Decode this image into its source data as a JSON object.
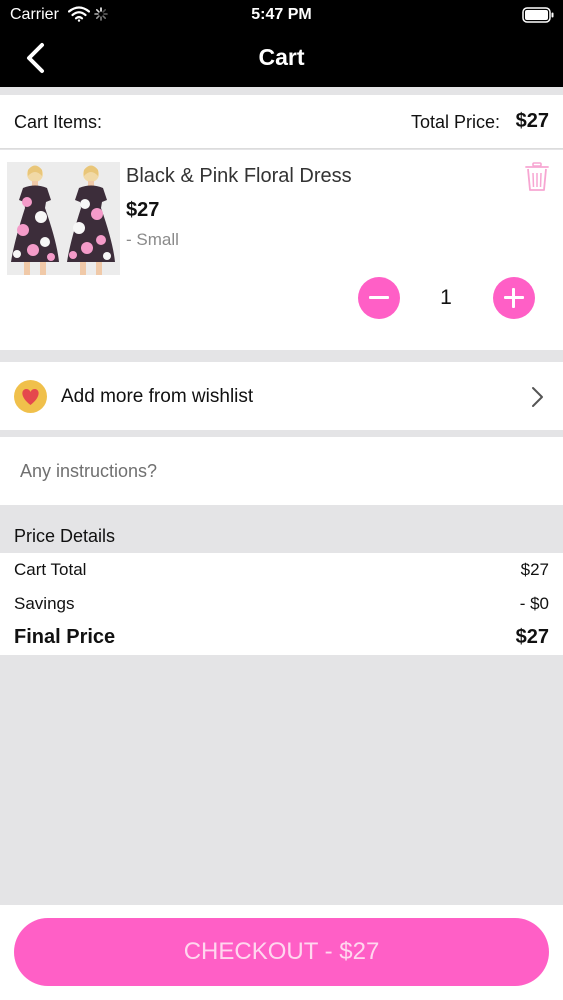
{
  "status_bar": {
    "carrier": "Carrier",
    "time": "5:47 PM"
  },
  "nav": {
    "title": "Cart",
    "back_icon": "chevron-left-icon"
  },
  "cart_header": {
    "items_label": "Cart Items:",
    "total_price_label": "Total Price:",
    "total_price_value": "$27"
  },
  "items": [
    {
      "name": "Black & Pink Floral Dress",
      "price": "$27",
      "size": "- Small",
      "quantity": "1"
    }
  ],
  "wishlist": {
    "label": "Add more from wishlist",
    "icon": "heart-icon"
  },
  "instructions": {
    "placeholder": "Any instructions?"
  },
  "price_details": {
    "title": "Price Details",
    "rows": [
      {
        "label": "Cart Total",
        "value": "$27"
      },
      {
        "label": "Savings",
        "value": "- $0"
      },
      {
        "label": "Final Price",
        "value": "$27"
      }
    ]
  },
  "checkout": {
    "label": "CHECKOUT - $27"
  },
  "colors": {
    "accent": "#ff5fc6",
    "bar_background": "#000000",
    "page_background": "#e4e4e6"
  }
}
